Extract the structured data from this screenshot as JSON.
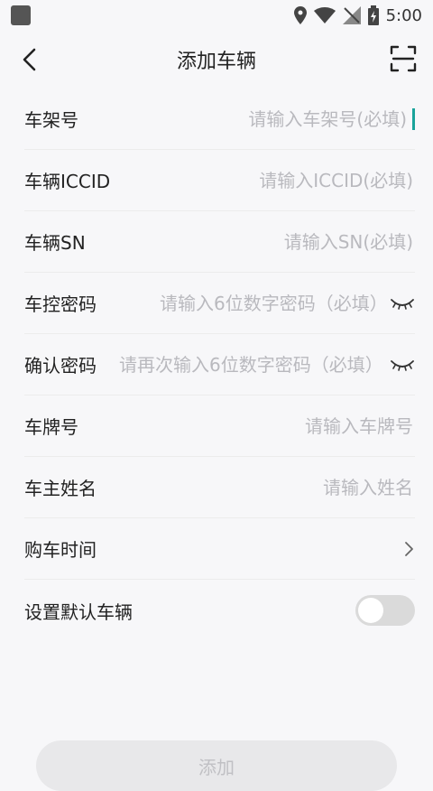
{
  "status_bar": {
    "time": "5:00"
  },
  "header": {
    "title": "添加车辆"
  },
  "form": {
    "frame_label": "车架号",
    "frame_placeholder": "请输入车架号(必填)",
    "iccid_label": "车辆ICCID",
    "iccid_placeholder": "请输入ICCID(必填)",
    "sn_label": "车辆SN",
    "sn_placeholder": "请输入SN(必填)",
    "control_pwd_label": "车控密码",
    "control_pwd_placeholder": "请输入6位数字密码（必填）",
    "confirm_pwd_label": "确认密码",
    "confirm_pwd_placeholder": "请再次输入6位数字密码（必填）",
    "plate_label": "车牌号",
    "plate_placeholder": "请输入车牌号",
    "owner_label": "车主姓名",
    "owner_placeholder": "请输入姓名",
    "purchase_time_label": "购车时间",
    "default_vehicle_label": "设置默认车辆",
    "default_vehicle_on": false
  },
  "add_button_label": "添加",
  "icons": {
    "back": "back-arrow-icon",
    "scan": "scan-icon",
    "eye": "eye-closed-icon",
    "chevron": "chevron-right-icon"
  }
}
